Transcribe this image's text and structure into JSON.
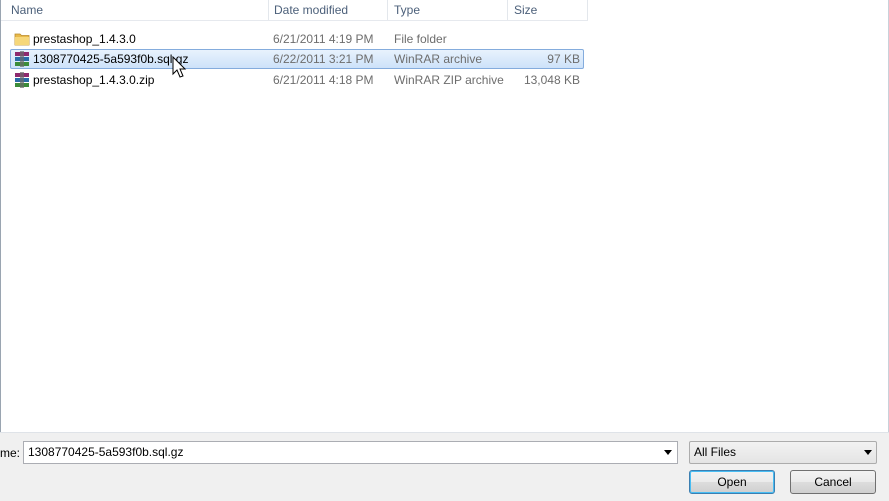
{
  "columns": {
    "name": "Name",
    "date_modified": "Date modified",
    "type": "Type",
    "size": "Size"
  },
  "files": [
    {
      "name": "prestashop_1.4.3.0",
      "date": "6/21/2011 4:19 PM",
      "type": "File folder",
      "size": "",
      "icon": "folder-icon",
      "selected": false
    },
    {
      "name": "1308770425-5a593f0b.sql.gz",
      "date": "6/22/2011 3:21 PM",
      "type": "WinRAR archive",
      "size": "97 KB",
      "icon": "winrar-archive-icon",
      "selected": true
    },
    {
      "name": "prestashop_1.4.3.0.zip",
      "date": "6/21/2011 4:18 PM",
      "type": "WinRAR ZIP archive",
      "size": "13,048 KB",
      "icon": "winrar-zip-icon",
      "selected": false
    }
  ],
  "filename": {
    "label": "me:",
    "value": "1308770425-5a593f0b.sql.gz"
  },
  "filetype": {
    "selected": "All Files"
  },
  "buttons": {
    "open": "Open",
    "cancel": "Cancel"
  },
  "colors": {
    "selection": "#cde2f9",
    "header_text": "#4c607a"
  }
}
